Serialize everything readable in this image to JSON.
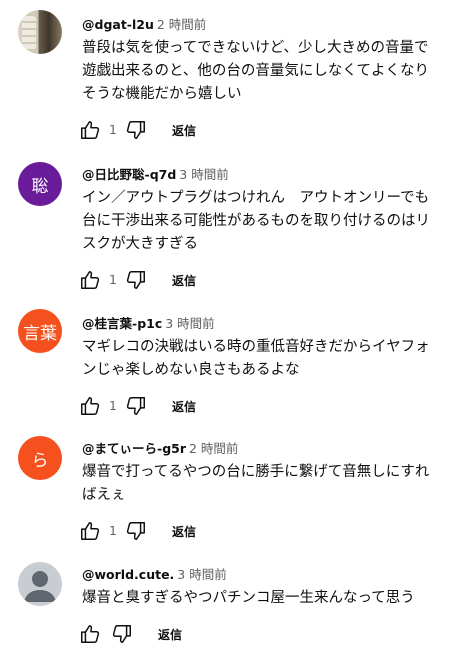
{
  "comments": [
    {
      "author": "@dgat-l2u",
      "time": "2 時間前",
      "lines": [
        "普段は気を使ってできないけど、少し大きめの音量で",
        "遊戯出来るのと、他の台の音量気にしなくてよくなり",
        "そうな機能だから嬉しい"
      ],
      "likes": "1",
      "reply": "返信",
      "avatar": {
        "type": "photo",
        "text": ""
      }
    },
    {
      "author": "@日比野聡-q7d",
      "time": "3 時間前",
      "lines": [
        "イン／アウトプラグはつけれん　アウトオンリーでも",
        "台に干渉出来る可能性があるものを取り付けるのはリ",
        "スクが大きすぎる"
      ],
      "likes": "1",
      "reply": "返信",
      "avatar": {
        "type": "letter",
        "text": "聡",
        "color": "#6a1b9a"
      }
    },
    {
      "author": "@桂言葉-p1c",
      "time": "3 時間前",
      "lines": [
        "マギレコの決戦はいる時の重低音好きだからイヤフォ",
        "ンじゃ楽しめない良さもあるよな"
      ],
      "likes": "1",
      "reply": "返信",
      "avatar": {
        "type": "letter",
        "text": "言葉",
        "color": "#f4511e"
      }
    },
    {
      "author": "@まてぃーら-g5r",
      "time": "2 時間前",
      "lines": [
        "爆音で打ってるやつの台に勝手に繋げて音無しにすれ",
        "ばえぇ"
      ],
      "likes": "1",
      "reply": "返信",
      "avatar": {
        "type": "letter",
        "text": "ら",
        "color": "#f4511e"
      }
    },
    {
      "author": "@world.cute.",
      "time": "3 時間前",
      "lines": [
        "爆音と臭すぎるやつパチンコ屋一生来んなって思う"
      ],
      "likes": "",
      "reply": "返信",
      "avatar": {
        "type": "default",
        "text": ""
      }
    }
  ]
}
